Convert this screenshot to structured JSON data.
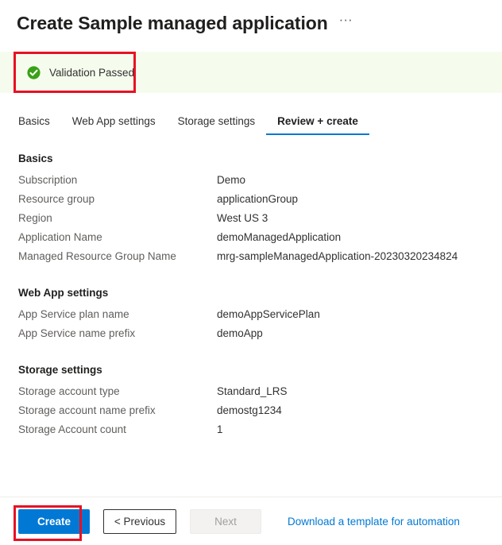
{
  "header": {
    "title": "Create Sample managed application",
    "more_menu": "···"
  },
  "validation": {
    "text": "Validation Passed",
    "icon": "check-circle-icon",
    "banner_color": "#f5fced",
    "icon_color": "#3aa017",
    "highlight_color": "#e81123"
  },
  "tabs": [
    {
      "label": "Basics",
      "active": false
    },
    {
      "label": "Web App settings",
      "active": false
    },
    {
      "label": "Storage settings",
      "active": false
    },
    {
      "label": "Review + create",
      "active": true
    }
  ],
  "sections": [
    {
      "heading": "Basics",
      "rows": [
        {
          "label": "Subscription",
          "value": "Demo"
        },
        {
          "label": "Resource group",
          "value": "applicationGroup"
        },
        {
          "label": "Region",
          "value": "West US 3"
        },
        {
          "label": "Application Name",
          "value": "demoManagedApplication"
        },
        {
          "label": "Managed Resource Group Name",
          "value": "mrg-sampleManagedApplication-20230320234824"
        }
      ]
    },
    {
      "heading": "Web App settings",
      "rows": [
        {
          "label": "App Service plan name",
          "value": "demoAppServicePlan"
        },
        {
          "label": "App Service name prefix",
          "value": "demoApp"
        }
      ]
    },
    {
      "heading": "Storage settings",
      "rows": [
        {
          "label": "Storage account type",
          "value": "Standard_LRS"
        },
        {
          "label": "Storage account name prefix",
          "value": "demostg1234"
        },
        {
          "label": "Storage Account count",
          "value": "1"
        }
      ]
    }
  ],
  "footer": {
    "create_label": "Create",
    "previous_label": "< Previous",
    "next_label": "Next",
    "download_link": "Download a template for automation",
    "accent_color": "#0078d4"
  }
}
